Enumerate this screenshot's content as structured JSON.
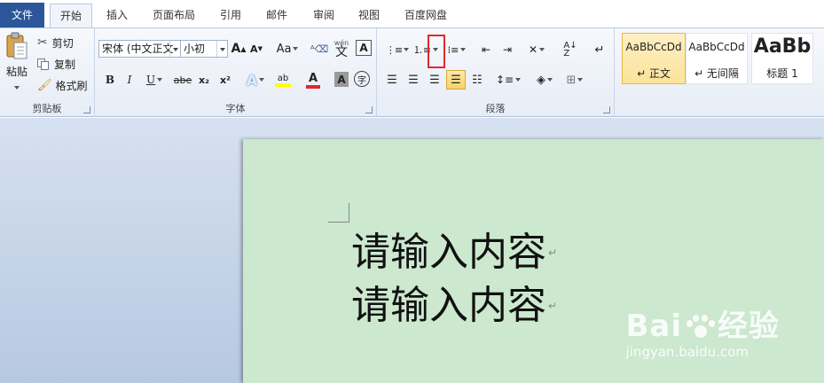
{
  "tabs": [
    "文件",
    "开始",
    "插入",
    "页面布局",
    "引用",
    "邮件",
    "审阅",
    "视图",
    "百度网盘"
  ],
  "active_tab": "开始",
  "clipboard": {
    "paste_label": "粘贴",
    "cut_label": "剪切",
    "copy_label": "复制",
    "format_painter_label": "格式刷",
    "group_label": "剪贴板"
  },
  "font": {
    "font_name": "宋体 (中文正文",
    "font_size": "小初",
    "grow_icon": "A",
    "shrink_icon": "A",
    "case_label": "Aa",
    "phonetic_label": "wén",
    "phonetic_char": "文",
    "border_char": "A",
    "bold": "B",
    "italic": "I",
    "underline": "U",
    "strike": "abe",
    "subscript": "x₂",
    "superscript": "x²",
    "text_effect": "A",
    "highlight": "ab",
    "font_color": "A",
    "char_shade": "A",
    "enclose": "字",
    "group_label": "字体"
  },
  "paragraph": {
    "group_label": "段落"
  },
  "styles": [
    {
      "sample": "AaBbCcDd",
      "name": "↵ 正文",
      "selected": true
    },
    {
      "sample": "AaBbCcDd",
      "name": "↵ 无间隔",
      "selected": false
    },
    {
      "sample": "AaBb",
      "name": "标题 1",
      "selected": false
    }
  ],
  "document": {
    "lines": [
      "请输入内容",
      "请输入内容"
    ],
    "para_mark": "↵"
  },
  "watermark": {
    "brand_left": "Bai",
    "brand_right": "经验",
    "url": "jingyan.baidu.com"
  },
  "colors": {
    "file_tab": "#2b579a",
    "page_bg": "#cce8cf",
    "highlight_border": "#e3262f",
    "style_selected": "#fbe39a"
  }
}
